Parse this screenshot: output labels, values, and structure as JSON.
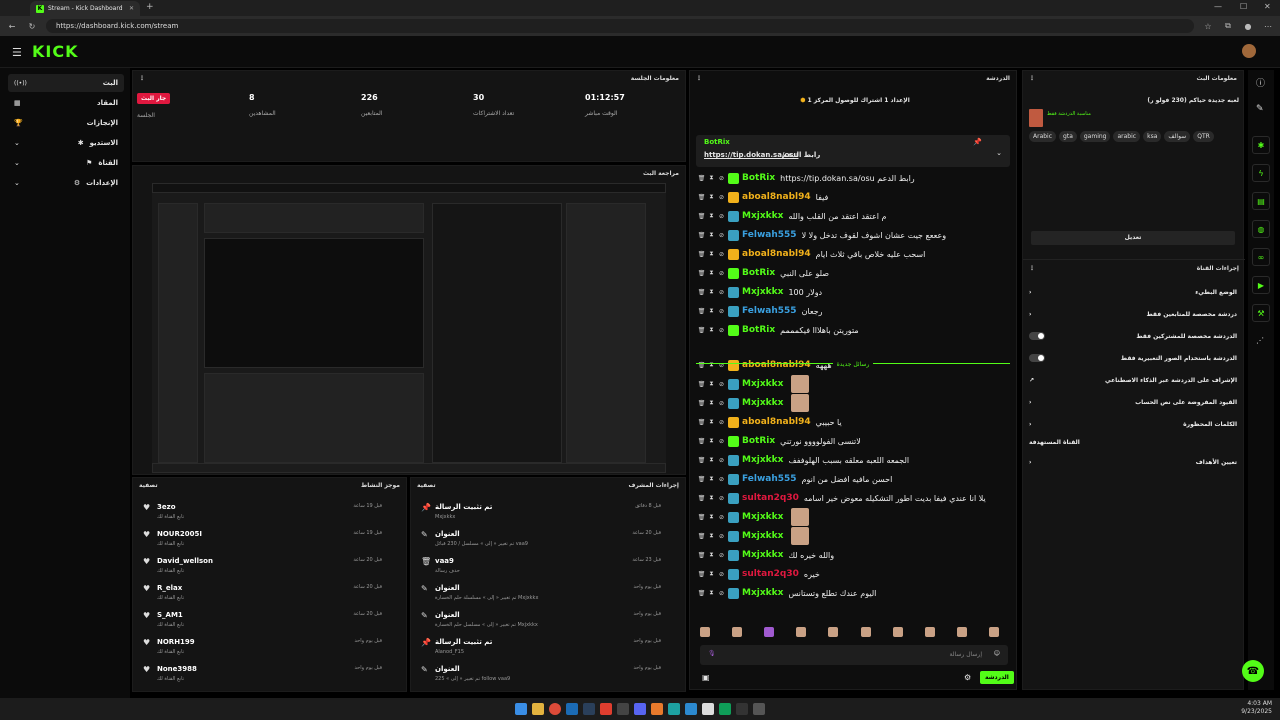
{
  "browser": {
    "tab_title": "Stream - Kick Dashboard",
    "url": "https://dashboard.kick.com/stream"
  },
  "app": {
    "logo": "KICK"
  },
  "nav": [
    {
      "label": "البث",
      "icon": "broadcast-icon",
      "active": true
    },
    {
      "label": "المقاد",
      "icon": "grid-icon",
      "active": false
    },
    {
      "label": "الإنجازات",
      "icon": "trophy-icon",
      "active": false
    },
    {
      "label": "الاستديو",
      "icon": "studio-icon",
      "active": false
    },
    {
      "label": "القناة",
      "icon": "channel-icon",
      "active": false
    },
    {
      "label": "الإعدادات",
      "icon": "gear-icon",
      "active": false
    }
  ],
  "session": {
    "title": "معلومات الجلسة",
    "live_badge": "جار البث",
    "live_label": "الجلسة",
    "stats": [
      {
        "value": "8",
        "label": "المشاهدين"
      },
      {
        "value": "226",
        "label": "المتابعين"
      },
      {
        "value": "30",
        "label": "تعداد الاشتراكات"
      },
      {
        "value": "01:12:57",
        "label": "الوقت مباشر"
      }
    ]
  },
  "preview": {
    "title": "مراجعة البث"
  },
  "activity": {
    "title": "موجز النشاط",
    "filter": "تصفية",
    "rows": [
      {
        "name": "3ezo",
        "sub": "تابع القناة لك",
        "time": "قبل 19 ساعة"
      },
      {
        "name": "NOUR2005I",
        "sub": "تابع القناة لك",
        "time": "قبل 19 ساعة"
      },
      {
        "name": "David_wellson",
        "sub": "تابع القناة لك",
        "time": "قبل 20 ساعة"
      },
      {
        "name": "R_elax",
        "sub": "تابع القناة لك",
        "time": "قبل 20 ساعة"
      },
      {
        "name": "S_AM1",
        "sub": "تابع القناة لك",
        "time": "قبل 20 ساعة"
      },
      {
        "name": "NORH199",
        "sub": "تابع القناة لك",
        "time": "قبل يوم واحد"
      },
      {
        "name": "None3988",
        "sub": "تابع القناة لك",
        "time": "قبل يوم واحد"
      }
    ]
  },
  "moderation": {
    "title": "إجراءات المشرف",
    "filter": "تصفية",
    "rows": [
      {
        "icon": "pin-icon",
        "name": "تم تثبيت الرسالة",
        "sub": "Mxjxkkx",
        "time": "قبل 8 دقائق"
      },
      {
        "icon": "edit-icon",
        "name": "العنوان",
        "sub": "تم تغيير « إلى » مسلسل / 230 قبائل vaa9",
        "time": "قبل 20 ساعة"
      },
      {
        "icon": "trash-icon",
        "name": "vaa9",
        "sub": "حذف رسالة",
        "time": "قبل 23 ساعة"
      },
      {
        "icon": "edit-icon",
        "name": "العنوان",
        "sub": "تم تغيير « إلى » مسلسلة حلم الخسارة Mxjxkkx",
        "time": "قبل يوم واحد"
      },
      {
        "icon": "edit-icon",
        "name": "العنوان",
        "sub": "تم تغيير « إلى » مسلسل حلم الخسارة Mxjxkkx",
        "time": "قبل يوم واحد"
      },
      {
        "icon": "pin-icon",
        "name": "تم تثبيت الرسالة",
        "sub": "Alanod_F15",
        "time": "قبل يوم واحد"
      },
      {
        "icon": "edit-icon",
        "name": "العنوان",
        "sub": "تم تغيير « إلى » 225 follow vaa9",
        "time": "قبل يوم واحد"
      }
    ]
  },
  "chat": {
    "title": "الدردشة",
    "goal": "الإعداد 1 اشتراك للوصول المركز 1",
    "pinned_user": "BotRix",
    "pinned_text": "رابط الدعم",
    "pinned_link": "https://tip.dokan.sa/osu",
    "new_messages": "رسائل جديدة",
    "input_placeholder": "إرسال رسالة",
    "send_label": "الدردشة",
    "messages": [
      {
        "user": "BotRix",
        "color": "#53fc18",
        "badge": "g",
        "text": "https://tip.dokan.sa/osu رابط الدعم"
      },
      {
        "user": "aboal8nabl94",
        "color": "#f1b11b",
        "badge": "y",
        "text": "فيفا"
      },
      {
        "user": "Mxjxkkx",
        "color": "#53fc18",
        "badge": "b",
        "text": "م اعتقد اعتقد من القلب والله"
      },
      {
        "user": "Felwah555",
        "color": "#3aa0e0",
        "badge": "b",
        "text": "وعععع جيت عشان اشوف لقوف تدخل ولا لا"
      },
      {
        "user": "aboal8nabl94",
        "color": "#f1b11b",
        "badge": "y",
        "text": "اسحب عليه خلاص باقي ثلاث ايام"
      },
      {
        "user": "BotRix",
        "color": "#53fc18",
        "badge": "g",
        "text": "صلو على النبي"
      },
      {
        "user": "Mxjxkkx",
        "color": "#53fc18",
        "badge": "b",
        "text": "دولار 100"
      },
      {
        "user": "Felwah555",
        "color": "#3aa0e0",
        "badge": "b",
        "text": "رجعان"
      },
      {
        "user": "BotRix",
        "color": "#53fc18",
        "badge": "g",
        "text": "متوريتن باهلااا فيكمممم"
      },
      {
        "user": "aboal8nabl94",
        "color": "#f1b11b",
        "badge": "y",
        "text": "هههه"
      },
      {
        "user": "Mxjxkkx",
        "color": "#53fc18",
        "badge": "b",
        "text": ""
      },
      {
        "user": "Mxjxkkx",
        "color": "#53fc18",
        "badge": "b",
        "text": ""
      },
      {
        "user": "aboal8nabl94",
        "color": "#f1b11b",
        "badge": "y",
        "text": "يا حبيبي"
      },
      {
        "user": "BotRix",
        "color": "#53fc18",
        "badge": "g",
        "text": "لاتنسى الفولوووو نورتني"
      },
      {
        "user": "Mxjxkkx",
        "color": "#53fc18",
        "badge": "b",
        "text": "الجمعه اللعبه معلقه بسبب الهلوففف"
      },
      {
        "user": "Felwah555",
        "color": "#3aa0e0",
        "badge": "b",
        "text": "احسن مافيه افضل من انوم"
      },
      {
        "user": "sultan2q30",
        "color": "#e0183f",
        "badge": "b",
        "text": "يلا انا عندي فيفا بديت اطور التشكيله معوض خير اسامه"
      },
      {
        "user": "Mxjxkkx",
        "color": "#53fc18",
        "badge": "b",
        "text": ""
      },
      {
        "user": "Mxjxkkx",
        "color": "#53fc18",
        "badge": "b",
        "text": ""
      },
      {
        "user": "Mxjxkkx",
        "color": "#53fc18",
        "badge": "b",
        "text": "والله خيره لك"
      },
      {
        "user": "sultan2q30",
        "color": "#e0183f",
        "badge": "b",
        "text": "خيره"
      },
      {
        "user": "Mxjxkkx",
        "color": "#53fc18",
        "badge": "b",
        "text": "اليوم عندك تطلع وتستانس"
      }
    ]
  },
  "stream_info": {
    "title": "معلومات البث",
    "stream_title": "لعبه جديده حياكم (230 فولو ر)",
    "category": "مناسبة الدردشة فقط",
    "tags": [
      "Arabic",
      "gta",
      "gaming",
      "arabic",
      "ksa",
      "سوالف",
      "QTR"
    ],
    "edit_button": "تعديل"
  },
  "channel_actions": {
    "title": "إجراءات القناة",
    "items": [
      {
        "label": "الوضع البطيء",
        "type": "chevron"
      },
      {
        "label": "دردشة مخصصة للمتابعين فقط",
        "type": "chevron"
      },
      {
        "label": "الدردشة مخصصة للمشتركين فقط",
        "type": "toggle"
      },
      {
        "label": "الدردشة باستخدام الصور التعبيرية فقط",
        "type": "toggle"
      },
      {
        "label": "الإشراف على الدردشة عبر الذكاء الاصطناعي",
        "type": "external"
      },
      {
        "label": "القيود المفروضة على نص الحساب",
        "type": "chevron"
      },
      {
        "label": "الكلمات المحظورة",
        "type": "chevron"
      },
      {
        "label": "القناة المستهدفة",
        "type": "none"
      },
      {
        "label": "تعيين الأهداف",
        "type": "chevron"
      }
    ]
  },
  "taskbar": {
    "time": "4:03 AM",
    "date": "9/23/2025"
  }
}
